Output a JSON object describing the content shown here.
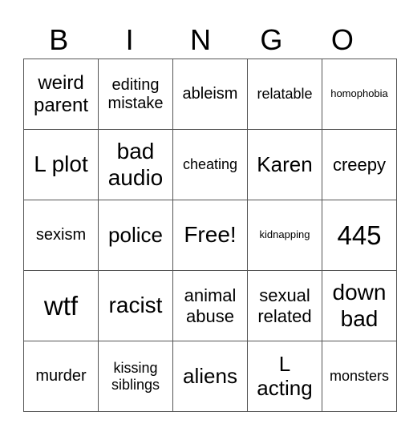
{
  "header": [
    "B",
    "I",
    "N",
    "G",
    "O"
  ],
  "cells": [
    [
      "weird parent",
      "editing mistake",
      "ableism",
      "relatable",
      "homophobia"
    ],
    [
      "L plot",
      "bad audio",
      "cheating",
      "Karen",
      "creepy"
    ],
    [
      "sexism",
      "police",
      "Free!",
      "kidnapping",
      "445"
    ],
    [
      "wtf",
      "racist",
      "animal abuse",
      "sexual related",
      "down bad"
    ],
    [
      "murder",
      "kissing siblings",
      "aliens",
      "L acting",
      "monsters"
    ]
  ]
}
